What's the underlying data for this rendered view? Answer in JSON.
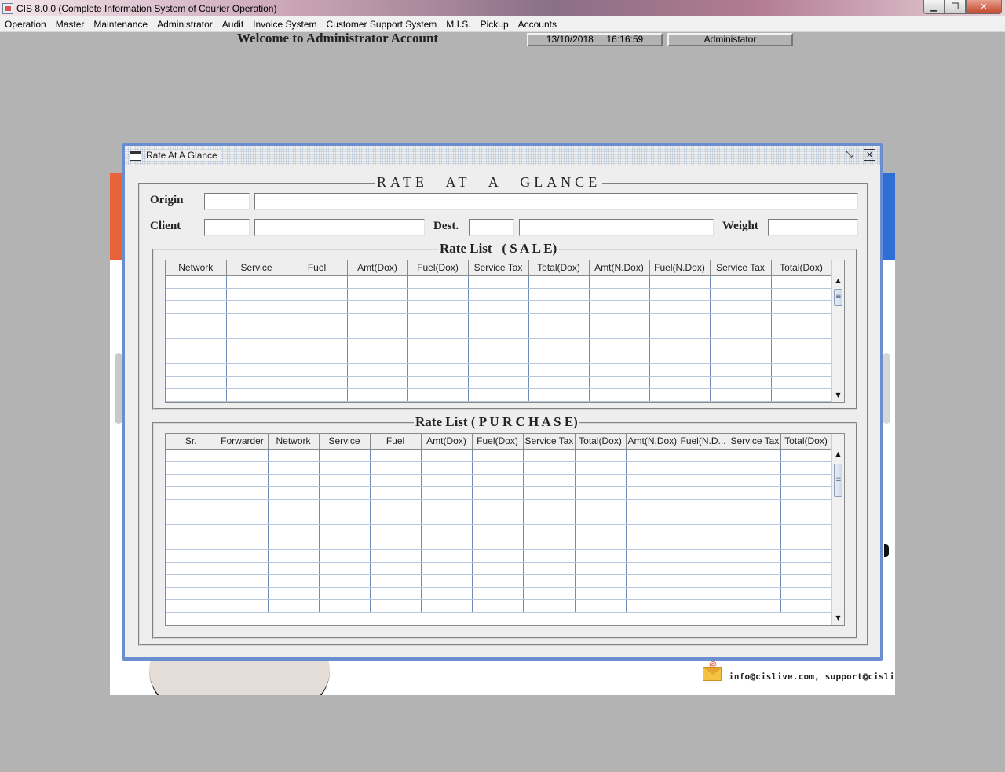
{
  "os": {
    "title": "CIS 8.0.0 (Complete Information System of Courier Operation)",
    "minimize_icon": "minimize-icon",
    "maximize_icon": "maximize-icon",
    "close_icon": "close-icon"
  },
  "menu": [
    "Operation",
    "Master",
    "Maintenance",
    "Administrator",
    "Audit",
    "Invoice System",
    "Customer Support System",
    "M.I.S.",
    "Pickup",
    "Accounts"
  ],
  "header": {
    "welcome": "Welcome to Administrator Account",
    "datetime": "13/10/2018     16:16:59",
    "user": "Administator"
  },
  "background": {
    "contact": "info@cislive.com, support@cislive.com",
    "accent_colors": {
      "left": "#e8623a",
      "right": "#2d6fd6"
    }
  },
  "dialog": {
    "title": "Rate At A Glance",
    "heading": "RATE AT A GLANCE",
    "border_color": "#6a8ed0",
    "form": {
      "origin_label": "Origin",
      "client_label": "Client",
      "dest_label": "Dest.",
      "weight_label": "Weight",
      "origin_code": "",
      "origin_name": "",
      "client_code": "",
      "client_name": "",
      "dest_code": "",
      "dest_name": "",
      "weight": ""
    },
    "sale": {
      "title": "Rate List   ( S A L E)",
      "columns": [
        "Network",
        "Service",
        "Fuel",
        "Amt(Dox)",
        "Fuel(Dox)",
        "Service Tax",
        "Total(Dox)",
        "Amt(N.Dox)",
        "Fuel(N.Dox)",
        "Service Tax",
        "Total(Dox)"
      ],
      "rows": []
    },
    "purchase": {
      "title": "Rate List ( P U R C H A S E)",
      "columns": [
        "Sr.",
        "Forwarder",
        "Network",
        "Service",
        "Fuel",
        "Amt(Dox)",
        "Fuel(Dox)",
        "Service Tax",
        "Total(Dox)",
        "Amt(N.Dox)",
        "Fuel(N.D...",
        "Service Tax",
        "Total(Dox)"
      ],
      "rows": []
    }
  }
}
